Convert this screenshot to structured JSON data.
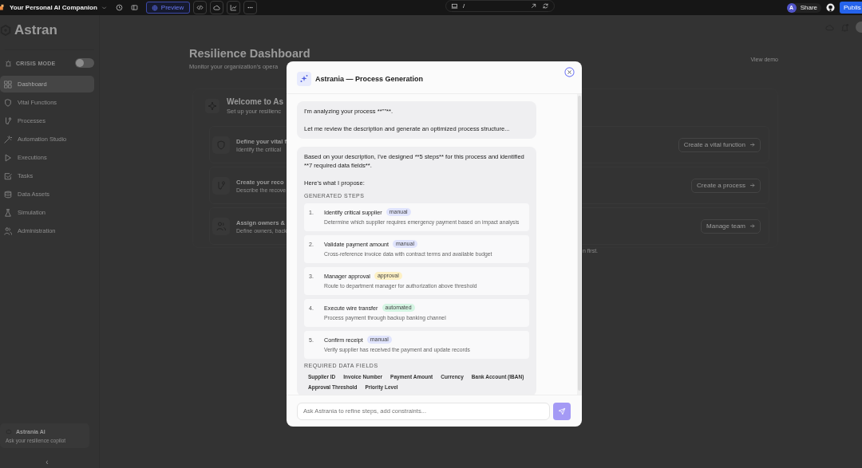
{
  "topbar": {
    "project": "Your Personal AI Companion",
    "preview": "Preview",
    "url": "/",
    "share": "Share",
    "avatar": "A",
    "publish": "Publis"
  },
  "sidebar": {
    "logo": "Astran",
    "crisis": {
      "label": "CRISIS MODE",
      "on": false
    },
    "items": [
      {
        "label": "Dashboard",
        "selected": true
      },
      {
        "label": "Vital Functions",
        "selected": false
      },
      {
        "label": "Processes",
        "selected": false
      },
      {
        "label": "Automation Studio",
        "selected": false
      },
      {
        "label": "Executions",
        "selected": false
      },
      {
        "label": "Tasks",
        "selected": false
      },
      {
        "label": "Data Assets",
        "selected": false
      },
      {
        "label": "Simulation",
        "selected": false
      },
      {
        "label": "Administration",
        "selected": false
      }
    ],
    "assistant": {
      "title": "Astrania AI",
      "subtitle": "Ask your resilience copilot"
    },
    "collapse": "‹"
  },
  "main": {
    "title": "Resilience Dashboard",
    "subtitle": "Monitor your organization's opera",
    "view_demo": "View demo",
    "welcome": {
      "title": "Welcome to As",
      "subtitle": "Set up your resilienc",
      "rows": [
        {
          "title": "Define your vital f",
          "desc": "Identify the critical",
          "action": "Create a vital function"
        },
        {
          "title": "Create your reco",
          "desc": "Describe the recove",
          "action": "Create a process"
        },
        {
          "title": "Assign owners &",
          "desc": "Define owners, back",
          "action": "Manage team"
        }
      ],
      "footer": "n first."
    }
  },
  "modal": {
    "title": "Astrania — Process Generation",
    "message_1": [
      "I'm analyzing your process **\"\"**.",
      "Let me review the description and generate an optimized process structure..."
    ],
    "message_2": {
      "intro": "Based on your description, I've designed **5 steps** for this process and identified **7 required data fields**.",
      "propose": "Here's what I propose:",
      "steps_heading": "GENERATED STEPS",
      "steps": [
        {
          "number": "1.",
          "title": "Identify critical supplier",
          "tag": {
            "label": "manual",
            "color": "#e0e4fd"
          },
          "desc": "Determine which supplier requires emergency payment based on impact analysis"
        },
        {
          "number": "2.",
          "title": "Validate payment amount",
          "tag": {
            "label": "manual",
            "color": "#e0e4fd"
          },
          "desc": "Cross-reference invoice data with contract terms and available budget"
        },
        {
          "number": "3.",
          "title": "Manager approval",
          "tag": {
            "label": "approval",
            "color": "#fdf0c4"
          },
          "desc": "Route to department manager for authorization above threshold"
        },
        {
          "number": "4.",
          "title": "Execute wire transfer",
          "tag": {
            "label": "automated",
            "color": "#d5f5e3"
          },
          "desc": "Process payment through backup banking channel"
        },
        {
          "number": "5.",
          "title": "Confirm receipt",
          "tag": {
            "label": "manual",
            "color": "#e0e4fd"
          },
          "desc": "Verify supplier has received the payment and update records"
        }
      ],
      "fields_heading": "REQUIRED DATA FIELDS",
      "fields": [
        "Supplier ID",
        "Invoice Number",
        "Payment Amount",
        "Currency",
        "Bank Account (IBAN)",
        "Approval Threshold",
        "Priority Level"
      ]
    },
    "input": {
      "placeholder": "Ask Astrania to refine steps, add constraints..."
    }
  }
}
